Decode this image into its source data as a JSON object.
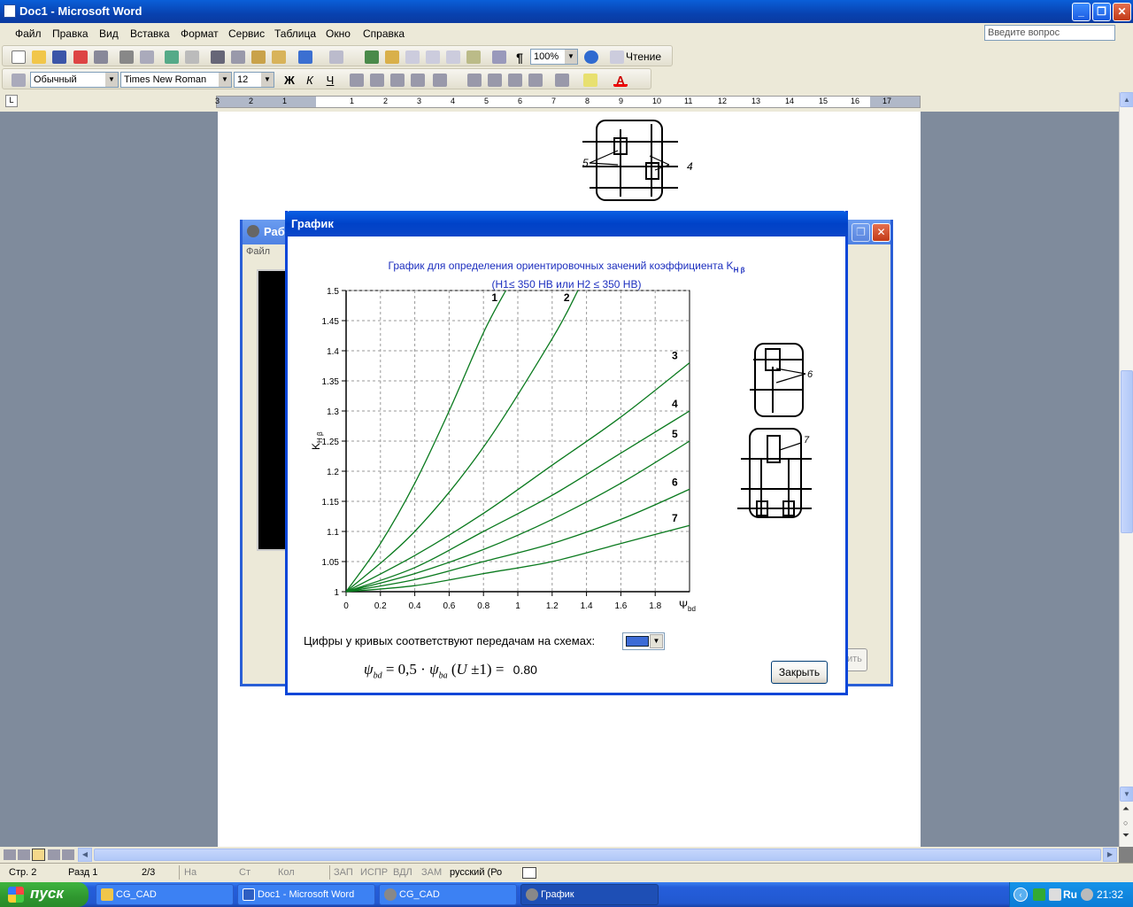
{
  "window": {
    "title": "Doc1 - Microsoft Word"
  },
  "menu": [
    "Файл",
    "Правка",
    "Вид",
    "Вставка",
    "Формат",
    "Сервис",
    "Таблица",
    "Окно",
    "Справка"
  ],
  "ask_placeholder": "Введите вопрос",
  "toolbar1": {
    "zoom": "100%",
    "reading": "Чтение"
  },
  "toolbar2": {
    "style": "Обычный",
    "font": "Times New Roman",
    "size": "12"
  },
  "ruler_labels": [
    "3",
    "2",
    "1",
    "1",
    "2",
    "3",
    "4",
    "5",
    "6",
    "7",
    "8",
    "9",
    "10",
    "11",
    "12",
    "13",
    "14",
    "15",
    "16",
    "17"
  ],
  "bg_dialog": {
    "title": "Рабо",
    "menu": "Файл",
    "hidden_button": "ить"
  },
  "dialog": {
    "title": "График",
    "chart_title_line1": "График для определения ориентировочных зачений коэффициента K",
    "chart_title_sub": "H β",
    "chart_title_line2": "(H1≤ 350 HB или H2 ≤ 350 HB)",
    "footer_label": "Цифры у кривых соответствуют передачам на схемах:",
    "formula_value": "0.80",
    "close_button": "Закрыть"
  },
  "chart_data": {
    "type": "line",
    "ylabel": "K",
    "ylabel_sub": "H β",
    "xlabel": "Ψ",
    "xlabel_sub": "bd",
    "xlim": [
      0,
      2.0
    ],
    "ylim": [
      1.0,
      1.5
    ],
    "x_ticks": [
      "0",
      "0.2",
      "0.4",
      "0.6",
      "0.8",
      "1",
      "1.2",
      "1.4",
      "1.6",
      "1.8"
    ],
    "y_ticks": [
      "1",
      "1.05",
      "1.1",
      "1.15",
      "1.2",
      "1.25",
      "1.3",
      "1.35",
      "1.4",
      "1.45",
      "1.5"
    ],
    "grid": true,
    "series_color": "#0a7a1e",
    "series": [
      {
        "label": "1",
        "x": [
          0,
          0.2,
          0.4,
          0.6,
          0.8,
          0.93
        ],
        "y": [
          1.0,
          1.08,
          1.18,
          1.3,
          1.43,
          1.5
        ]
      },
      {
        "label": "2",
        "x": [
          0,
          0.4,
          0.8,
          1.2,
          1.35
        ],
        "y": [
          1.0,
          1.1,
          1.24,
          1.42,
          1.5
        ]
      },
      {
        "label": "3",
        "x": [
          0,
          0.4,
          0.8,
          1.2,
          1.6,
          2.0
        ],
        "y": [
          1.0,
          1.06,
          1.13,
          1.21,
          1.29,
          1.38
        ]
      },
      {
        "label": "4",
        "x": [
          0,
          0.4,
          0.8,
          1.2,
          1.6,
          2.0
        ],
        "y": [
          1.0,
          1.04,
          1.1,
          1.16,
          1.23,
          1.3
        ]
      },
      {
        "label": "5",
        "x": [
          0,
          0.4,
          0.8,
          1.2,
          1.6,
          2.0
        ],
        "y": [
          1.0,
          1.03,
          1.07,
          1.12,
          1.18,
          1.25
        ]
      },
      {
        "label": "6",
        "x": [
          0,
          0.4,
          0.8,
          1.2,
          1.6,
          2.0
        ],
        "y": [
          1.0,
          1.02,
          1.05,
          1.08,
          1.12,
          1.17
        ]
      },
      {
        "label": "7",
        "x": [
          0,
          0.4,
          0.8,
          1.2,
          1.6,
          2.0
        ],
        "y": [
          1.0,
          1.01,
          1.03,
          1.05,
          1.08,
          1.11
        ]
      }
    ]
  },
  "scheme_labels": {
    "top_scheme": "6",
    "bottom_scheme": "7",
    "doc_scheme_left": "5",
    "doc_scheme_right": "4"
  },
  "status": {
    "page": "Стр. 2",
    "section": "Разд 1",
    "pages": "2/3",
    "at": "На",
    "line": "Ст",
    "col": "Кол",
    "rec": "ЗАП",
    "trk": "ИСПР",
    "ext": "ВДЛ",
    "ovr": "ЗАМ",
    "lang": "русский (Ро"
  },
  "taskbar": {
    "start": "пуск",
    "tasks": [
      {
        "label": "CG_CAD",
        "active": false
      },
      {
        "label": "Doc1 - Microsoft Word",
        "active": false
      },
      {
        "label": "CG_CAD",
        "active": false
      },
      {
        "label": "График",
        "active": true
      }
    ],
    "lang": "Ru",
    "clock": "21:32"
  }
}
